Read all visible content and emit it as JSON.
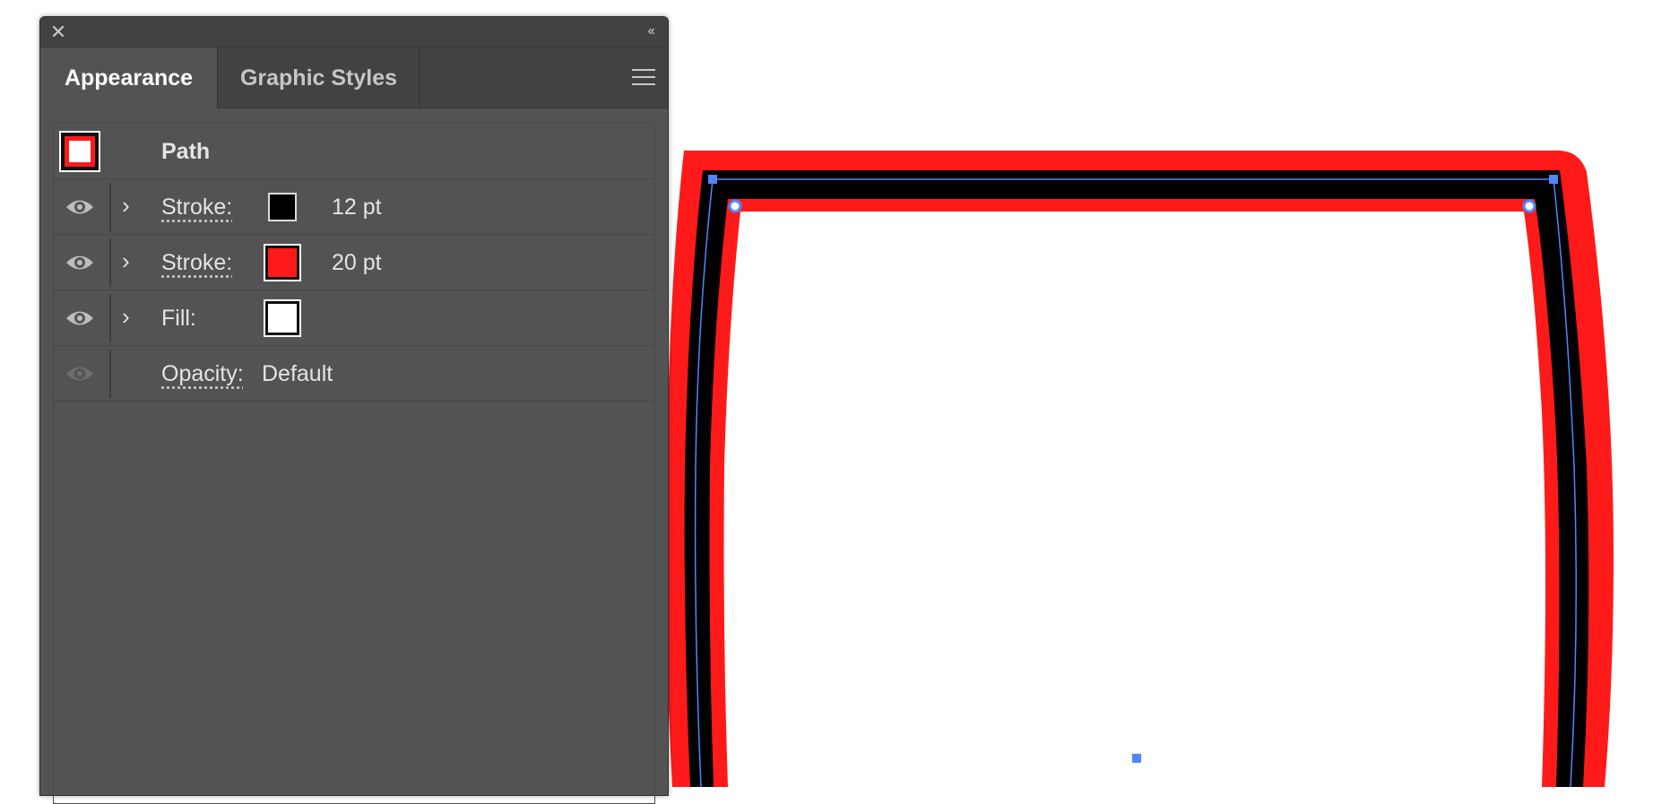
{
  "panel": {
    "tabs": [
      {
        "label": "Appearance",
        "active": true
      },
      {
        "label": "Graphic Styles",
        "active": false
      }
    ],
    "close_glyph": "✕",
    "collapse_glyph": "‹‹",
    "menu_icon": "hamburger-menu-icon"
  },
  "appearance": {
    "object_type": "Path",
    "rows": [
      {
        "label": "Stroke:",
        "swatch_color": "#000000",
        "weight": "12 pt"
      },
      {
        "label": "Stroke:",
        "swatch_color": "#ff1a1a",
        "weight": "20 pt"
      },
      {
        "label": "Fill:",
        "swatch_color": "#ffffff"
      },
      {
        "label": "Opacity:",
        "value": "Default"
      }
    ]
  },
  "colors": {
    "panel_bg": "#535353",
    "tab_bar_bg": "#424242",
    "stroke_outer": "#ff1a1a",
    "stroke_inner": "#000000",
    "selection": "#4f86ff"
  }
}
